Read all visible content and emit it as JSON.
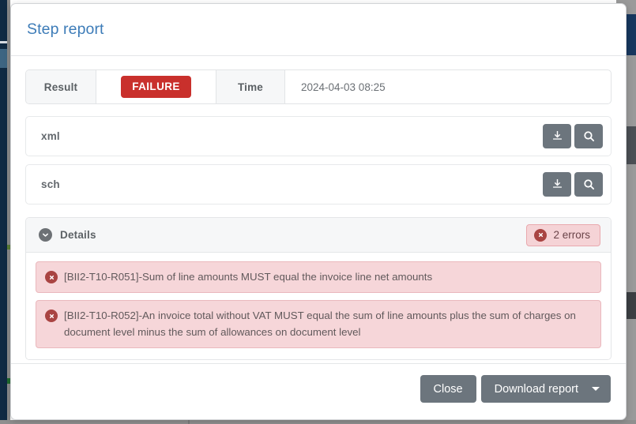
{
  "modal": {
    "title": "Step report"
  },
  "summary": {
    "result_label": "Result",
    "result_value": "FAILURE",
    "time_label": "Time",
    "time_value": "2024-04-03 08:25"
  },
  "artifacts": [
    {
      "name": "xml",
      "download_icon": "download-icon",
      "view_icon": "search-icon"
    },
    {
      "name": "sch",
      "download_icon": "download-icon",
      "view_icon": "search-icon"
    }
  ],
  "details": {
    "label": "Details",
    "toggle_icon": "chevron-down-circle-icon",
    "errors_badge": "2 errors",
    "errors_badge_icon": "error-circle-icon",
    "errors": [
      {
        "icon": "error-circle-icon",
        "text": "[BII2-T10-R051]-Sum of line amounts MUST equal the invoice line net amounts"
      },
      {
        "icon": "error-circle-icon",
        "text": "[BII2-T10-R052]-An invoice total without VAT MUST equal the sum of line amounts plus the sum of charges on document level minus the sum of allowances on document level"
      }
    ]
  },
  "footer": {
    "close_label": "Close",
    "download_label": "Download report",
    "dropdown_icon": "caret-down-icon"
  },
  "colors": {
    "title": "#3d7cb8",
    "failure_badge": "#c9302c",
    "button": "#6c757d",
    "error_bg": "#f6d6d9",
    "error_border": "#eab8bd",
    "error_icon": "#a94442",
    "panel_header_bg": "#f6f7f8"
  }
}
